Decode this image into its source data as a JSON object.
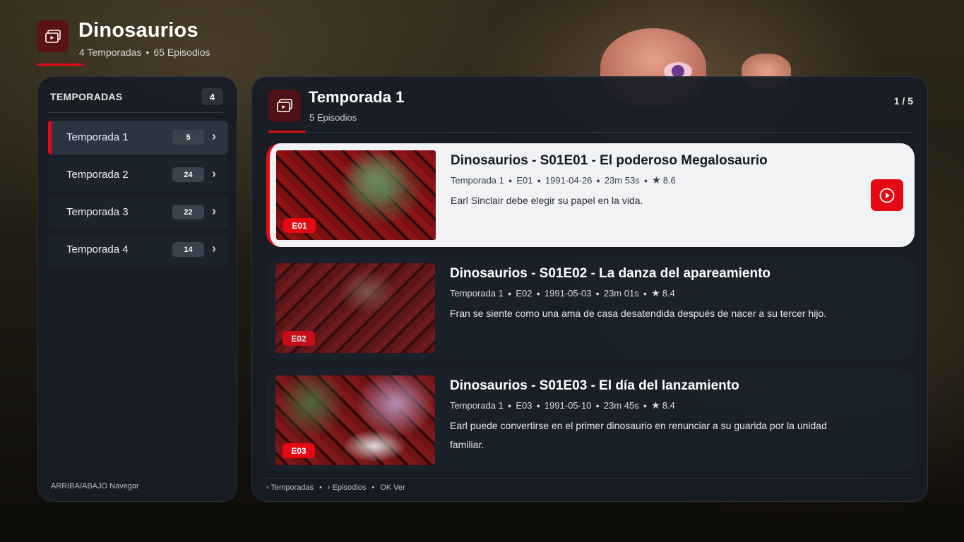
{
  "colors": {
    "accent": "#e50914",
    "panel": "#171d26",
    "focused_card": "#f1f2f4"
  },
  "header": {
    "title": "Dinosaurios",
    "seasons_text": "4 Temporadas",
    "episodes_text": "65 Episodios",
    "separator": "•",
    "icon": "series-icon"
  },
  "sidebar": {
    "title": "TEMPORADAS",
    "count": "4",
    "items": [
      {
        "label": "Temporada 1",
        "episodes": "5",
        "active": true
      },
      {
        "label": "Temporada 2",
        "episodes": "24",
        "active": false
      },
      {
        "label": "Temporada 3",
        "episodes": "22",
        "active": false
      },
      {
        "label": "Temporada 4",
        "episodes": "14",
        "active": false
      }
    ],
    "chevron": "›",
    "hint": "ARRIBA/ABAJO Navegar"
  },
  "season_panel": {
    "title": "Temporada 1",
    "subtitle": "5 Episodios",
    "page": "1 / 5",
    "icon": "series-icon"
  },
  "episodes": [
    {
      "badge": "E01",
      "title": "Dinosaurios - S01E01 - El poderoso Megalosaurio",
      "season": "Temporada 1",
      "code": "E01",
      "date": "1991-04-26",
      "duration": "23m 53s",
      "rating": "8.6",
      "description": "Earl Sinclair debe elegir su papel en la vida.",
      "focused": true
    },
    {
      "badge": "E02",
      "title": "Dinosaurios - S01E02 - La danza del apareamiento",
      "season": "Temporada 1",
      "code": "E02",
      "date": "1991-05-03",
      "duration": "23m 01s",
      "rating": "8.4",
      "description": "Fran se siente como una ama de casa desatendida después de nacer a su tercer hijo.",
      "focused": false
    },
    {
      "badge": "E03",
      "title": "Dinosaurios - S01E03 - El día del lanzamiento",
      "season": "Temporada 1",
      "code": "E03",
      "date": "1991-05-10",
      "duration": "23m 45s",
      "rating": "8.4",
      "description": "Earl puede convertirse en el primer dinosaurio en renunciar a su guarida por la unidad familiar.",
      "focused": false
    }
  ],
  "meta_separator": "●",
  "star": "★",
  "footer_hints": {
    "seasons": "‹ Temporadas",
    "episodes": "› Episodios",
    "ok": "OK Ver",
    "separator": "•"
  }
}
